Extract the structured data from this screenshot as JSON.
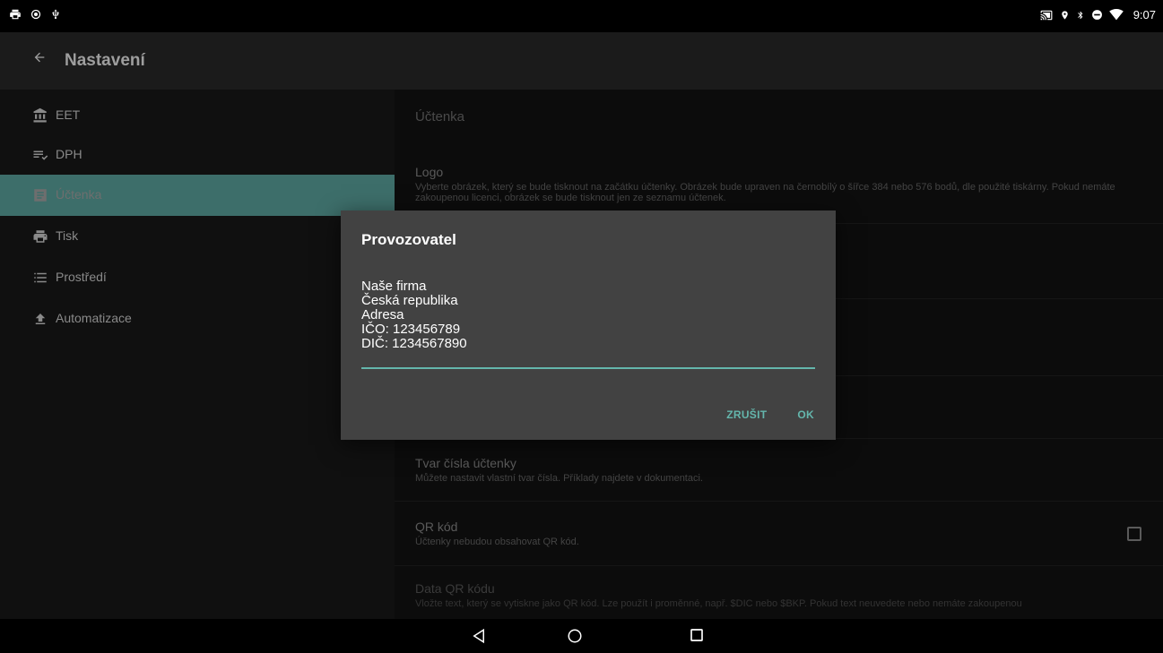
{
  "status_bar": {
    "time": "9:07",
    "left_icons": [
      "printer-icon",
      "location-circle-icon",
      "usb-icon"
    ],
    "right_icons": [
      "cast-icon",
      "location-icon",
      "bluetooth-icon",
      "do-not-disturb-icon",
      "wifi-icon"
    ]
  },
  "app_bar": {
    "title": "Nastavení",
    "back_icon": "arrow-back-icon"
  },
  "sidebar": {
    "items": [
      {
        "label": "EET",
        "icon": "bank-icon"
      },
      {
        "label": "DPH",
        "icon": "list-check-icon"
      },
      {
        "label": "Účtenka",
        "icon": "receipt-icon",
        "active": true
      },
      {
        "label": "Tisk",
        "icon": "printer-icon"
      },
      {
        "label": "Prostředí",
        "icon": "list-icon"
      },
      {
        "label": "Automatizace",
        "icon": "upload-icon"
      }
    ]
  },
  "content": {
    "section_title": "Účtenka",
    "prefs": [
      {
        "title": "Logo",
        "summary": "Vyberte obrázek, který se bude tisknout na začátku účtenky. Obrázek bude upraven na černobílý o šířce 384 nebo 576 bodů, dle použité tiskárny. Pokud nemáte zakoupenou licenci, obrázek se bude tisknout jen ze seznamu účtenek."
      },
      {
        "title": "Tvar čísla účtenky",
        "summary": "Můžete nastavit vlastní tvar čísla. Příklady najdete v dokumentaci."
      },
      {
        "title": "QR kód",
        "summary": "Účtenky nebudou obsahovat QR kód.",
        "checked": false
      },
      {
        "title": "Data QR kódu",
        "summary": "Vložte text, který se vytiskne jako QR kód. Lze použít i proměnné, např. $DIC nebo $BKP. Pokud text neuvedete nebo nemáte zakoupenou"
      }
    ]
  },
  "dialog": {
    "title": "Provozovatel",
    "lines": [
      "Naše firma",
      "Česká republika",
      "Adresa",
      "IČO: 123456789",
      "DIČ: 1234567890"
    ],
    "cancel_label": "ZRUŠIT",
    "ok_label": "OK",
    "accent_color": "#64b6ac"
  },
  "nav_bar": {
    "icons": [
      "back-triangle-icon",
      "home-circle-icon",
      "recents-square-icon"
    ]
  }
}
